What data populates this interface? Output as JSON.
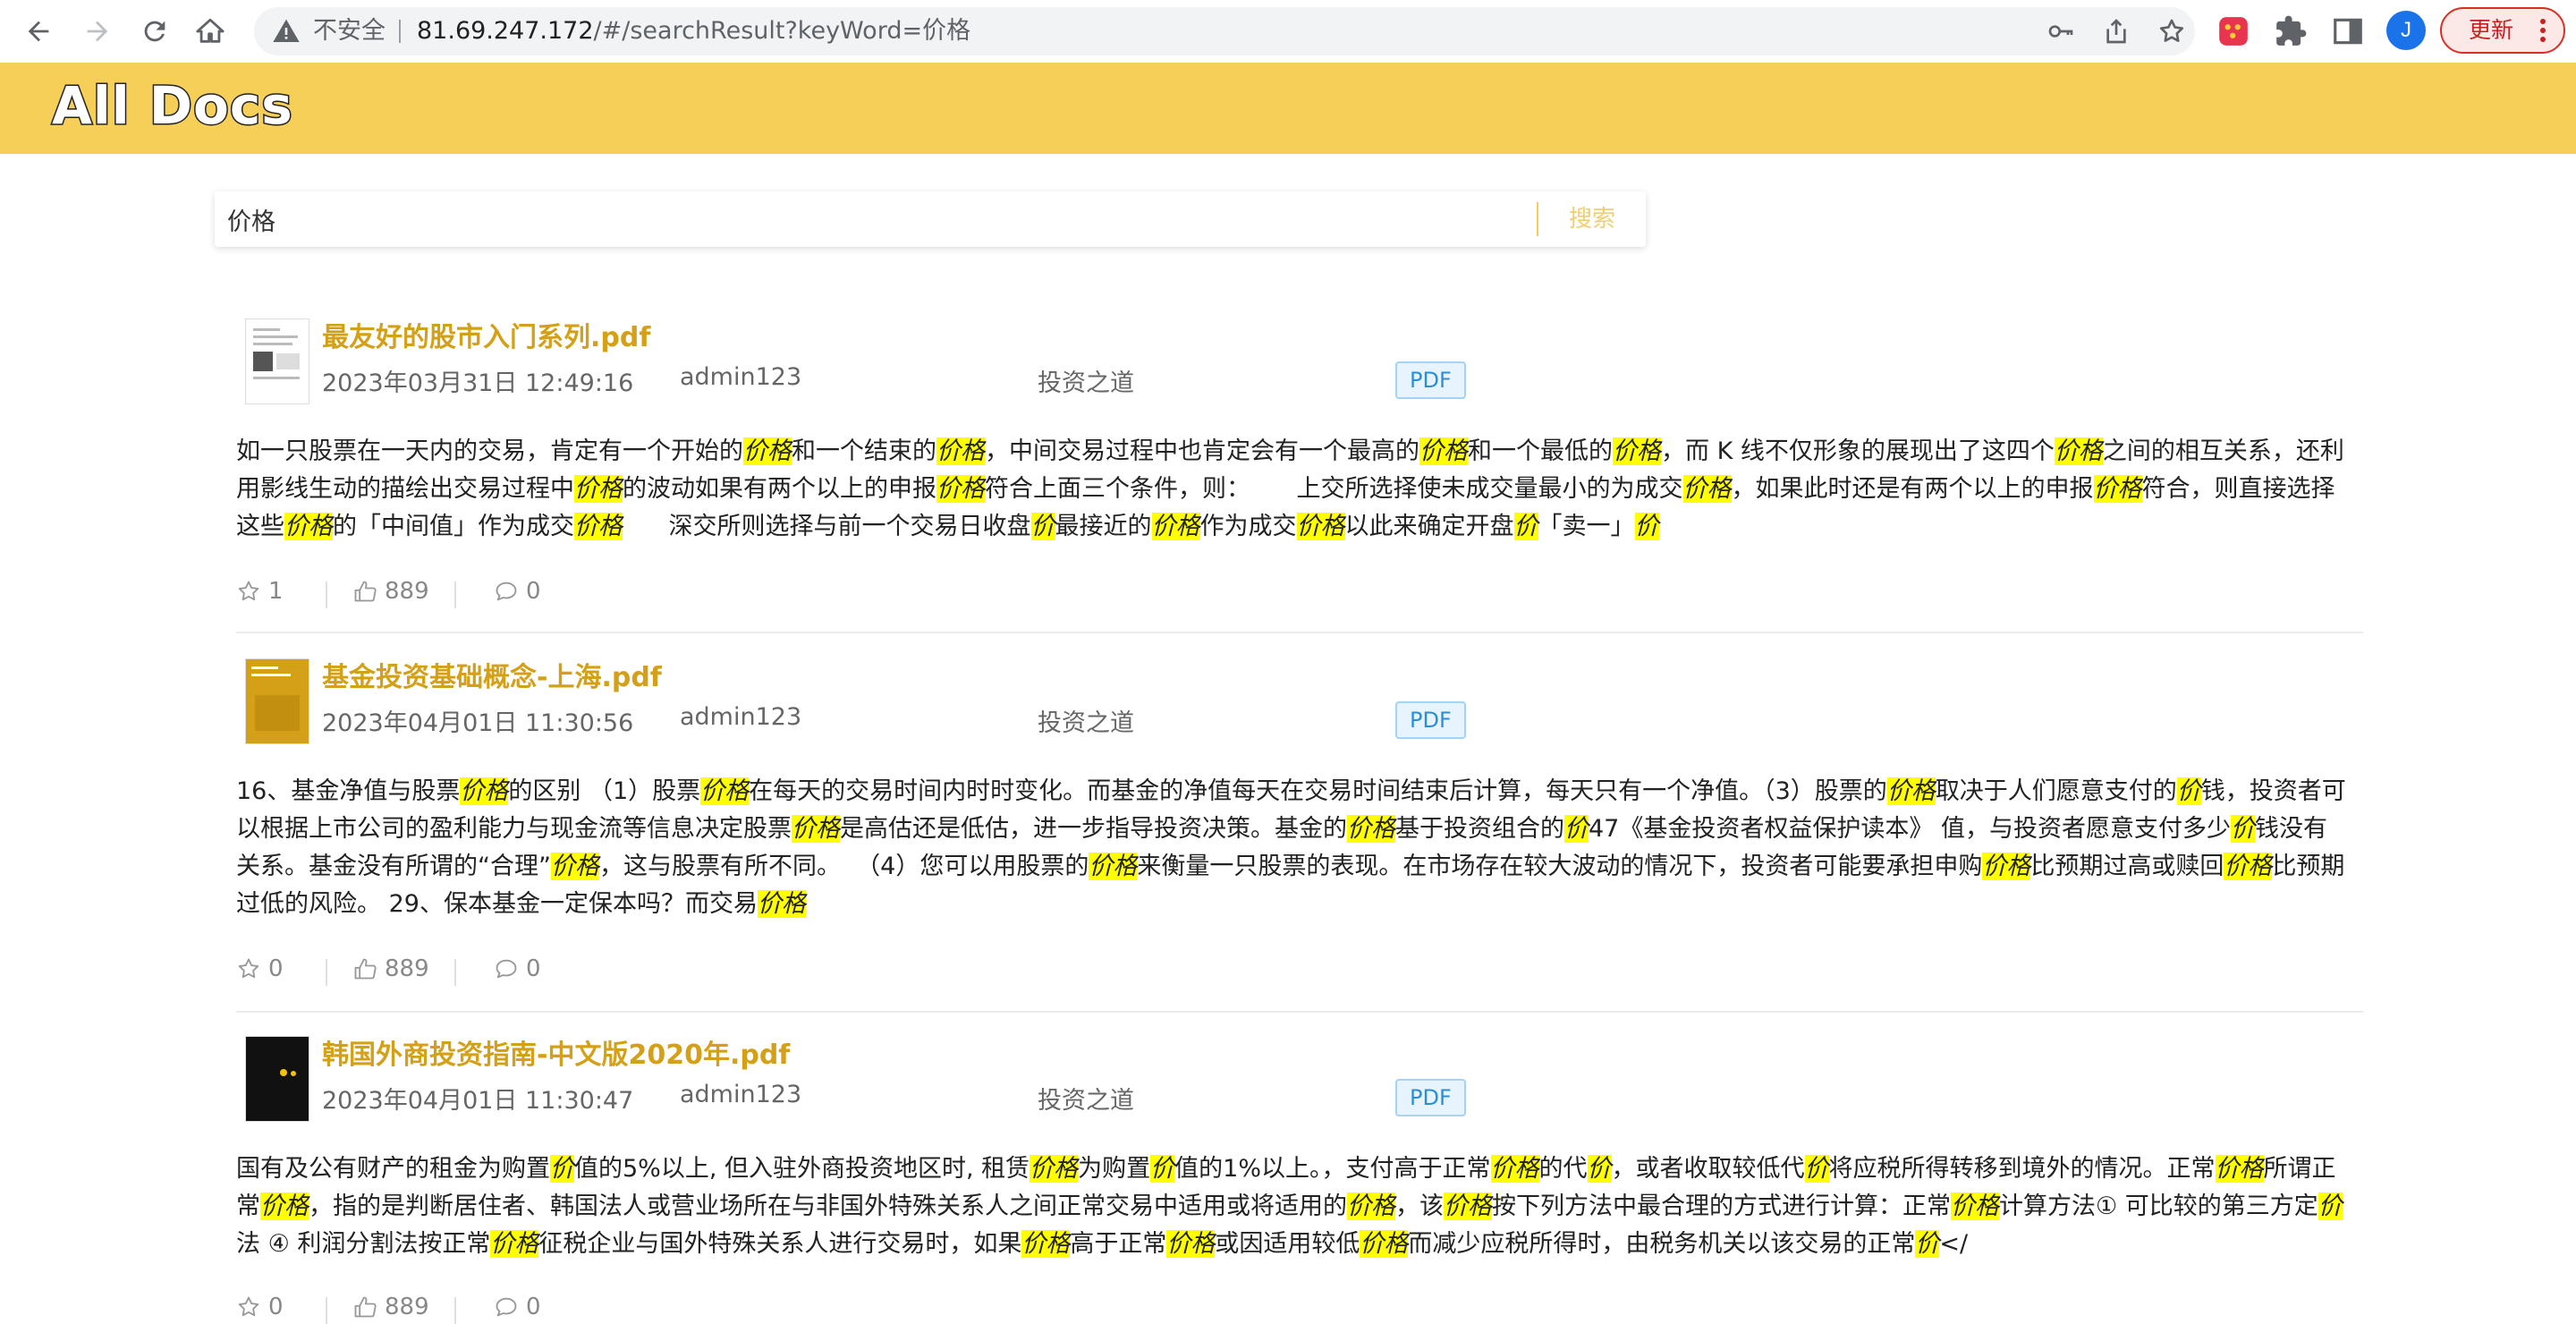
{
  "browser": {
    "insecure_label": "不安全",
    "url_host": "81.69.247.172",
    "url_path": "/#/searchResult?keyWord=价格",
    "profile_initial": "J",
    "update_label": "更新"
  },
  "site": {
    "logo": "All Docs"
  },
  "search": {
    "value": "价格",
    "button_label": "搜索"
  },
  "results": [
    {
      "title": "最友好的股市入门系列.pdf",
      "date": "2023年03月31日 12:49:16",
      "author": "admin123",
      "category": "投资之道",
      "type": "PDF",
      "snippet_html": "如一只股票在一天内的交易，肯定有一个开始的<em>价格</em>和一个结束的<em>价格</em>，中间交易过程中也肯定会有一个最高的<em>价格</em>和一个最低的<em>价格</em>，而 K 线不仅形象的展现出了这四个<em>价格</em>之间的相互关系，还利用影线生动的描绘出交易过程中<em>价格</em>的波动如果有两个以上的申报<em>价格</em>符合上面三个条件，则：&nbsp;&nbsp;&nbsp;&nbsp;&nbsp;&nbsp;上交所选择使未成交量最小的为成交<em>价格</em>，如果此时还是有两个以上的申报<em>价格</em>符合，则直接选择这些<em>价格</em>的「中间值」作为成交<em>价格</em>&nbsp;&nbsp;&nbsp;&nbsp;&nbsp;&nbsp;深交所则选择与前一个交易日收盘<em>价</em>最接近的<em>价格</em>作为成交<em>价格</em>以此来确定开盘<em>价</em>「卖一」<em>价</em>",
      "stars": "1",
      "likes": "889",
      "comments": "0"
    },
    {
      "title": "基金投资基础概念-上海.pdf",
      "date": "2023年04月01日 11:30:56",
      "author": "admin123",
      "category": "投资之道",
      "type": "PDF",
      "snippet_html": "16、基金净值与股票<em>价格</em>的区别 （1）股票<em>价格</em>在每天的交易时间内时时变化。而基金的净值每天在交易时间结束后计算，每天只有一个净值。（3）股票的<em>价格</em>取决于人们愿意支付的<em>价</em>钱，投资者可以根据上市公司的盈利能力与现金流等信息决定股票<em>价格</em>是高估还是低估，进一步指导投资决策。基金的<em>价格</em>基于投资组合的<em>价</em>47《基金投资者权益保护读本》 值，与投资者愿意支付多少<em>价</em>钱没有关系。基金没有所谓的“合理”<em>价格</em>，这与股票有所不同。&nbsp;&nbsp;（4）您可以用股票的<em>价格</em>来衡量一只股票的表现。在市场存在较大波动的情况下，投资者可能要承担申购<em>价格</em>比预期过高或赎回<em>价格</em>比预期过低的风险。 29、保本基金一定保本吗？而交易<em>价格</em>",
      "stars": "0",
      "likes": "889",
      "comments": "0"
    },
    {
      "title": "韩国外商投资指南-中文版2020年.pdf",
      "date": "2023年04月01日 11:30:47",
      "author": "admin123",
      "category": "投资之道",
      "type": "PDF",
      "snippet_html": "国有及公有财产的租金为购置<em>价</em>值的5%以上, 但入驻外商投资地区时, 租赁<em>价格</em>为购置<em>价</em>值的1%以上。，支付高于正常<em>价格</em>的代<em>价</em>，或者收取较低代<em>价</em>将应税所得转移到境外的情况。正常<em>价格</em>所谓正常<em>价格</em>，指的是判断居住者、韩国法人或营业场所在与非国外特殊关系人之间正常交易中适用或将适用的<em>价格</em>，该<em>价格</em>按下列方法中最合理的方式进行计算：正常<em>价格</em>计算方法① 可比较的第三方定<em>价</em>法 ④ 利润分割法按正常<em>价格</em>征税企业与国外特殊关系人进行交易时，如果<em>价格</em>高于正常<em>价格</em>或因适用较低<em>价格</em>而减少应税所得时，由税务机关以该交易的正常<em>价</em>&lt;/",
      "stars": "0",
      "likes": "889",
      "comments": "0"
    }
  ],
  "colors": {
    "header_bg": "#f5cf57",
    "title": "#d4a017",
    "highlight": "#ffff00",
    "badge_text": "#2b8fd6"
  },
  "icons": {
    "back": "arrow-left-icon",
    "forward": "arrow-right-icon",
    "reload": "reload-icon",
    "home": "home-icon",
    "warning": "warning-icon",
    "key": "key-icon",
    "share": "share-icon",
    "bookmark": "star-icon",
    "extension": "puzzle-icon",
    "side_panel": "side-panel-icon",
    "star": "star-outline-icon",
    "like": "thumb-up-icon",
    "comment": "comment-icon"
  }
}
